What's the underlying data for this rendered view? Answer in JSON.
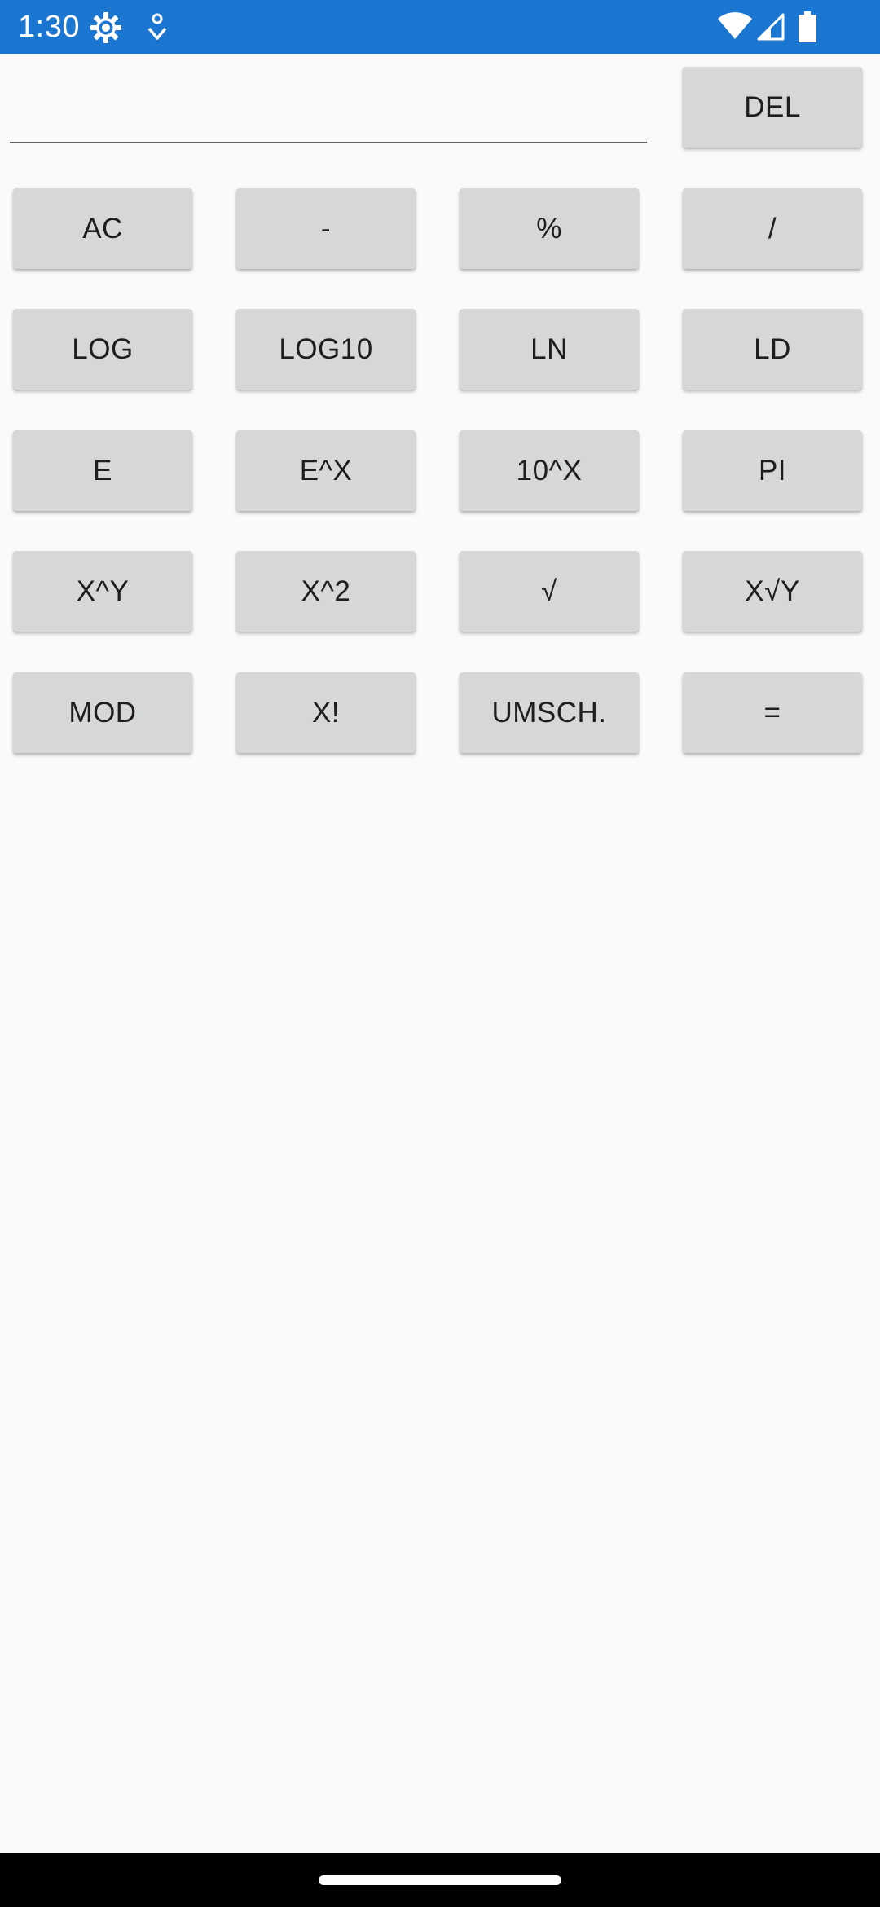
{
  "status_bar": {
    "time": "1:30",
    "background": "#1b76d2",
    "icons": [
      "gear-icon",
      "assistant-icon",
      "wifi-icon",
      "cell-signal-icon",
      "battery-icon"
    ]
  },
  "display": {
    "value": "",
    "placeholder": ""
  },
  "buttons": {
    "del": "DEL",
    "ac": "AC",
    "minus": "-",
    "percent": "%",
    "divide": "/",
    "log": "LOG",
    "log10": "LOG10",
    "ln": "LN",
    "ld": "LD",
    "e": "E",
    "e_pow_x": "E^X",
    "ten_pow_x": "10^X",
    "pi": "PI",
    "x_pow_y": "X^Y",
    "x_squared": "X^2",
    "sqrt": "√",
    "x_root_y": "X√Y",
    "mod": "MOD",
    "factorial": "X!",
    "shift": "UMSCH.",
    "equals": "="
  },
  "colors": {
    "button_bg": "#d6d7d7",
    "page_bg": "#fafafa",
    "nav_bar": "#000000"
  }
}
